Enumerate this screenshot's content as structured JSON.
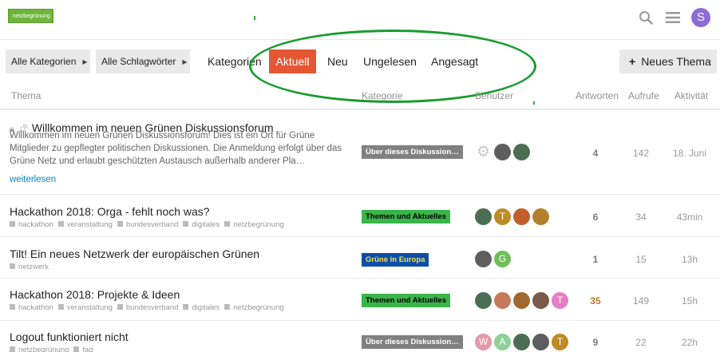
{
  "header": {
    "logo_text": "netzbegrünung",
    "user_initial": "S",
    "icons": [
      "search-icon",
      "hamburger-menu-icon"
    ]
  },
  "nav": {
    "all_categories": "Alle Kategorien",
    "all_tags": "Alle Schlagwörter",
    "tabs": [
      "Kategorien",
      "Aktuell",
      "Neu",
      "Ungelesen",
      "Angesagt"
    ],
    "active_tab": "Aktuell",
    "new_topic": "Neues Thema"
  },
  "columns": {
    "topic": "Thema",
    "category": "Kategorie",
    "users": "Benutzer",
    "replies": "Antworten",
    "views": "Aufrufe",
    "activity": "Aktivität"
  },
  "topics": [
    {
      "title": "Willkommen im neuen Grünen Diskussionsforum",
      "icons": [
        "lock-icon",
        "pin-icon"
      ],
      "excerpt": "Willkommen im neuen Grünen Diskussionsforum! Dies ist ein Ort für Grüne Mitglieder zu gepflegter politischen Diskussionen. Die Anmeldung erfolgt über das Grüne Netz und erlaubt geschützten Austausch außerhalb anderer Pla…",
      "read_more": "weiterlesen",
      "category": "Über dieses Diskussion…",
      "replies": "4",
      "views": "142",
      "activity": "18. Juni"
    },
    {
      "title": "Hackathon 2018: Orga - fehlt noch was?",
      "tags": [
        "hackathon",
        "veranstaltung",
        "bundesverband",
        "digitales",
        "netzbegrünung"
      ],
      "category": "Themen und Aktuelles",
      "replies": "6",
      "views": "34",
      "activity": "43min"
    },
    {
      "title": "Tilt! Ein neues Netzwerk der europäischen Grünen",
      "tags": [
        "netzwerk"
      ],
      "category": "Grüne in Europa",
      "replies": "1",
      "views": "15",
      "activity": "13h"
    },
    {
      "title": "Hackathon 2018: Projekte & Ideen",
      "tags": [
        "hackathon",
        "veranstaltung",
        "bundesverband",
        "digitales",
        "netzbegrünung"
      ],
      "category": "Themen und Aktuelles",
      "replies": "35",
      "views": "149",
      "activity": "15h"
    },
    {
      "title": "Logout funktioniert nicht",
      "tags": [
        "netzbegrünung",
        "faq"
      ],
      "category": "Über dieses Diskussion…",
      "replies": "9",
      "views": "22",
      "activity": "22h"
    }
  ],
  "poster_initials": {
    "row2": "T",
    "row3": "G",
    "row4": "T",
    "row5": [
      "W",
      "A",
      "T"
    ]
  },
  "colors": {
    "active_tab": "#e45735",
    "highlight_ellipse": "#1a9b2d",
    "category_about": "#808080",
    "category_themes": "#3ab54a",
    "category_europe": "#0e4ea8",
    "link": "#0a84c1",
    "hot_replies": "#b47a2a"
  }
}
